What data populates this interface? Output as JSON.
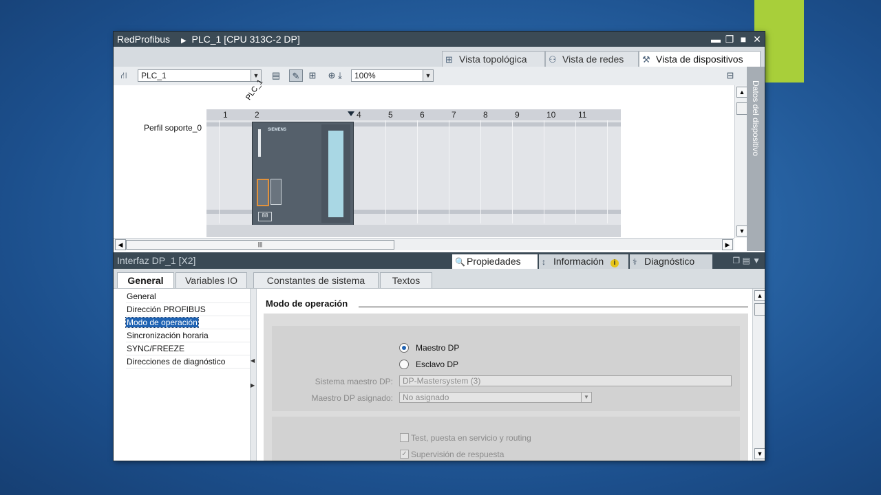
{
  "window": {
    "breadcrumb": [
      "RedProfibus",
      "PLC_1 [CPU 313C-2 DP]"
    ],
    "controls": {
      "minimize": "▬",
      "restore": "❐",
      "maximize": "■",
      "close": "✕"
    }
  },
  "view_tabs": [
    {
      "label": "Vista topológica",
      "icon": "topology-view-icon"
    },
    {
      "label": "Vista de redes",
      "icon": "network-view-icon"
    },
    {
      "label": "Vista de dispositivos",
      "icon": "device-view-icon",
      "active": true
    }
  ],
  "toolbar": {
    "device_select": "PLC_1",
    "zoom": "100%"
  },
  "canvas": {
    "device_label": "PLC_1",
    "rack_name": "Perfil soporte_0",
    "slots": [
      "1",
      "2",
      "4",
      "5",
      "6",
      "7",
      "8",
      "9",
      "10",
      "11"
    ],
    "cpu_brand": "SIEMENS",
    "cpu_display": "88"
  },
  "side_panel": {
    "label": "Datos del dispositivo"
  },
  "inspector": {
    "title": "Interfaz DP_1 [X2]",
    "tabs": [
      {
        "label": "Propiedades",
        "icon": "properties-icon",
        "active": true
      },
      {
        "label": "Información",
        "icon": "info-icon",
        "badge": "i"
      },
      {
        "label": "Diagnóstico",
        "icon": "diagnostics-icon"
      }
    ]
  },
  "subtabs": [
    {
      "label": "General",
      "active": true
    },
    {
      "label": "Variables IO"
    },
    {
      "label": "Constantes de sistema"
    },
    {
      "label": "Textos"
    }
  ],
  "nav": [
    {
      "label": "General"
    },
    {
      "label": "Dirección PROFIBUS"
    },
    {
      "label": "Modo de operación",
      "selected": true
    },
    {
      "label": "Sincronización horaria"
    },
    {
      "label": "SYNC/FREEZE"
    },
    {
      "label": "Direcciones de diagnóstico"
    }
  ],
  "content": {
    "section_title": "Modo de operación",
    "radio_master": "Maestro DP",
    "radio_slave": "Esclavo DP",
    "master_system_label": "Sistema maestro DP:",
    "master_system_value": "DP-Mastersystem (3)",
    "assigned_master_label": "Maestro DP asignado:",
    "assigned_master_value": "No asignado",
    "check_test": "Test, puesta en servicio y routing",
    "check_supervision": "Supervisión de respuesta"
  },
  "colors": {
    "accent_green": "#a8cf3a",
    "title_bar": "#3b4a55",
    "selection": "#1f63b3",
    "port_highlight": "#e2923c"
  }
}
